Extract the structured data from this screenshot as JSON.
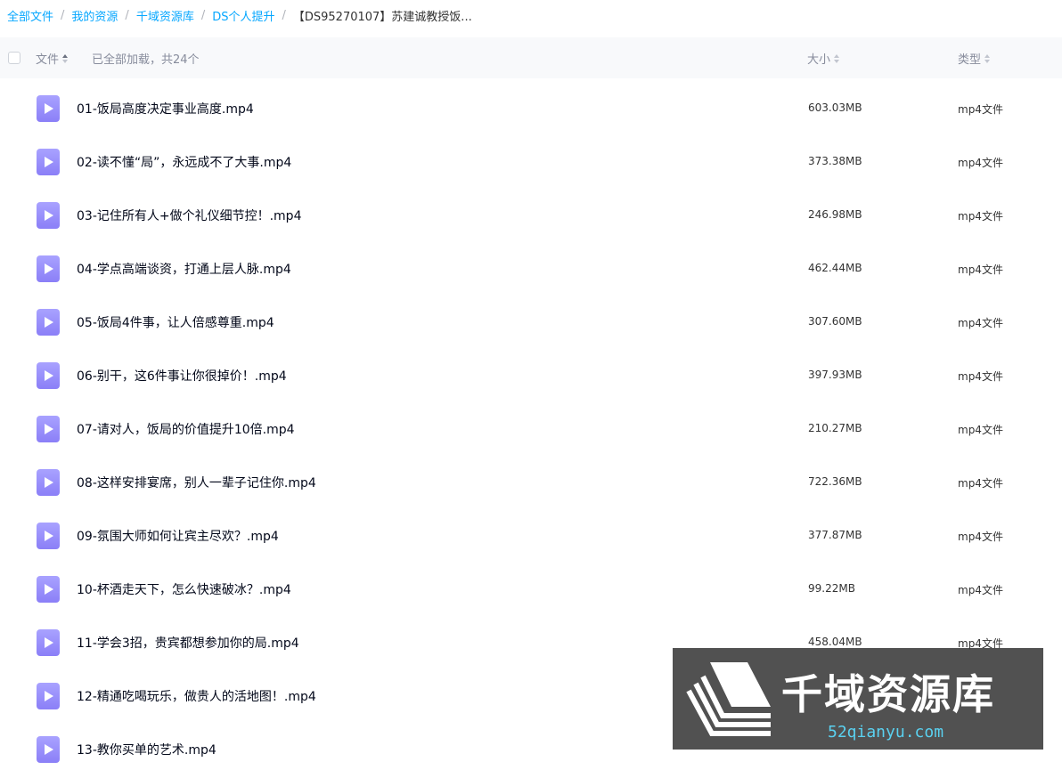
{
  "breadcrumb": [
    {
      "label": "全部文件"
    },
    {
      "label": "我的资源"
    },
    {
      "label": "千域资源库"
    },
    {
      "label": "DS个人提升"
    },
    {
      "label": "【DS95270107】苏建诚教授饭..."
    }
  ],
  "breadcrumb_separator": "/",
  "header": {
    "name_label": "文件",
    "loaded_text": "已全部加载，共24个",
    "size_label": "大小",
    "type_label": "类型"
  },
  "files": [
    {
      "name": "01-饭局高度决定事业高度.mp4",
      "size": "603.03MB",
      "type": "mp4文件",
      "icon": "video-file-icon"
    },
    {
      "name": "02-读不懂“局”，永远成不了大事.mp4",
      "size": "373.38MB",
      "type": "mp4文件",
      "icon": "video-file-icon"
    },
    {
      "name": "03-记住所有人+做个礼仪细节控！.mp4",
      "size": "246.98MB",
      "type": "mp4文件",
      "icon": "video-file-icon"
    },
    {
      "name": "04-学点高端谈资，打通上层人脉.mp4",
      "size": "462.44MB",
      "type": "mp4文件",
      "icon": "video-file-icon"
    },
    {
      "name": "05-饭局4件事，让人倍感尊重.mp4",
      "size": "307.60MB",
      "type": "mp4文件",
      "icon": "video-file-icon"
    },
    {
      "name": "06-别干，这6件事让你很掉价！.mp4",
      "size": "397.93MB",
      "type": "mp4文件",
      "icon": "video-file-icon"
    },
    {
      "name": "07-请对人，饭局的价值提升10倍.mp4",
      "size": "210.27MB",
      "type": "mp4文件",
      "icon": "video-file-icon"
    },
    {
      "name": "08-这样安排宴席，别人一辈子记住你.mp4",
      "size": "722.36MB",
      "type": "mp4文件",
      "icon": "video-file-icon"
    },
    {
      "name": "09-氛围大师如何让宾主尽欢？.mp4",
      "size": "377.87MB",
      "type": "mp4文件",
      "icon": "video-file-icon"
    },
    {
      "name": "10-杯酒走天下，怎么快速破冰？.mp4",
      "size": "99.22MB",
      "type": "mp4文件",
      "icon": "video-file-icon"
    },
    {
      "name": "11-学会3招，贵宾都想参加你的局.mp4",
      "size": "458.04MB",
      "type": "mp4文件",
      "icon": "video-file-icon"
    },
    {
      "name": "12-精通吃喝玩乐，做贵人的活地图！.mp4",
      "size": "",
      "type": "",
      "icon": "video-file-icon"
    },
    {
      "name": "13-教你买单的艺术.mp4",
      "size": "",
      "type": "",
      "icon": "video-file-icon"
    }
  ],
  "watermark": {
    "title": "千域资源库",
    "url": "52qianyu.com"
  },
  "colors": {
    "link": "#06a7ff",
    "header_bg": "#f8f9fb",
    "file_icon": "#9b92fb",
    "watermark_url": "#5ad1f0"
  }
}
